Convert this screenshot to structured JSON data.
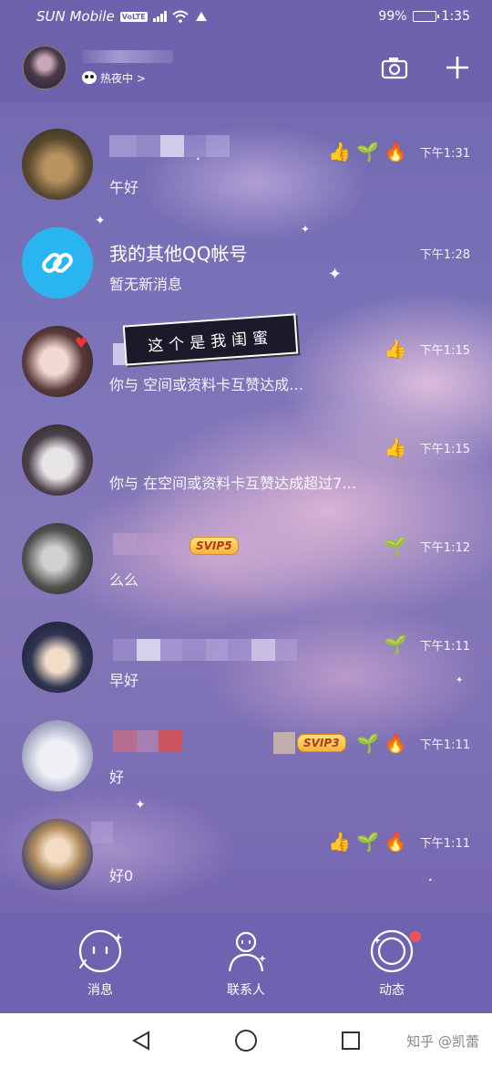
{
  "status_bar": {
    "carrier": "SUN Mobile",
    "volte": "VoLTE",
    "battery": "99%",
    "battery_level": 0.99,
    "time": "1:35"
  },
  "header": {
    "status_text": "热夜中 >",
    "camera_icon": "camera-icon",
    "add_icon": "plus-icon"
  },
  "conversations": [
    {
      "message": "午好",
      "time": "下午1:31",
      "icons": [
        "👍",
        "🌱",
        "🔥"
      ]
    },
    {
      "name": "我的其他QQ帐号",
      "message": "暂无新消息",
      "time": "下午1:28",
      "icons": []
    },
    {
      "message": "你与          空间或资料卡互赞达成…",
      "time": "下午1:15",
      "icons": [
        "👍"
      ],
      "note": "这个是我闺蜜"
    },
    {
      "message": "你与  在空间或资料卡互赞达成超过7…",
      "time": "下午1:15",
      "icons": [
        "👍"
      ]
    },
    {
      "message": "么么",
      "time": "下午1:12",
      "icons": [
        "🌱"
      ],
      "badge": "SVIP5"
    },
    {
      "message": "早好",
      "time": "下午1:11",
      "icons": [
        "🌱"
      ]
    },
    {
      "message": "好",
      "time": "下午1:11",
      "icons": [
        "🌱",
        "🔥"
      ],
      "badge": "SVIP3"
    },
    {
      "message": "好0",
      "time": "下午1:11",
      "icons": [
        "👍",
        "🌱",
        "🔥"
      ]
    }
  ],
  "tabs": [
    {
      "label": "消息",
      "icon": "face-icon"
    },
    {
      "label": "联系人",
      "icon": "contacts-icon"
    },
    {
      "label": "动态",
      "icon": "moon-icon"
    }
  ],
  "navbar": {
    "back_icon": "back-triangle-icon",
    "home_icon": "home-circle-icon",
    "recents_icon": "recents-square-icon",
    "watermark": "知乎 @凯蕾"
  },
  "colors": {
    "accent": "#6d62ad",
    "badge_red": "#ef5350",
    "link_avatar": "#2bb5f0"
  }
}
